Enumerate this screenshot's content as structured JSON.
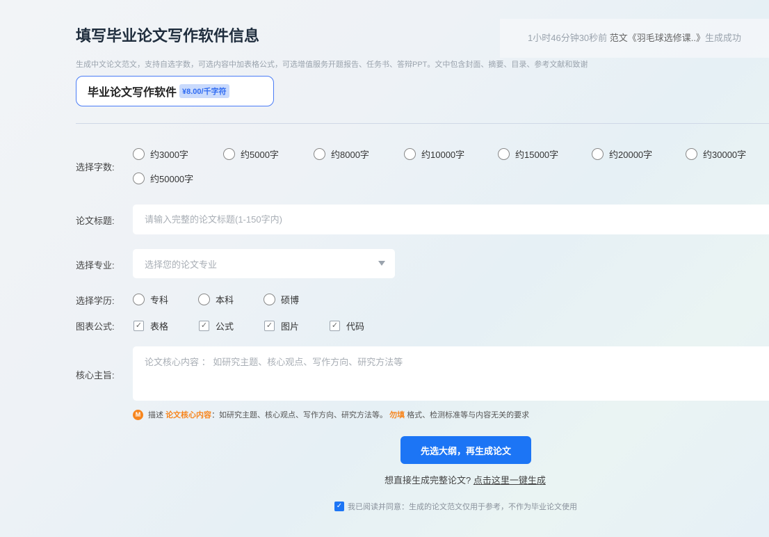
{
  "page_title": "填写毕业论文写作软件信息",
  "notice": {
    "time_text": "1小时46分钟30秒前",
    "mid": "范文《羽毛球选修课..》",
    "status": "生成成功"
  },
  "description": "生成中文论文范文，支持自选字数，可选内容中加表格公式，可选增值服务开题报告、任务书、答辩PPT。文中包含封面、摘要、目录、参考文献和致谢",
  "product": {
    "name": "毕业论文写作软件",
    "price": "¥8.00/千字符"
  },
  "word_count": {
    "label": "选择字数:",
    "options": [
      "约3000字",
      "约5000字",
      "约8000字",
      "约10000字",
      "约15000字",
      "约20000字",
      "约30000字",
      "约50000字"
    ]
  },
  "paper_title": {
    "label": "论文标题:",
    "placeholder": "请输入完整的论文标题(1-150字内)"
  },
  "major": {
    "label": "选择专业:",
    "placeholder": "选择您的论文专业"
  },
  "education": {
    "label": "选择学历:",
    "options": [
      "专科",
      "本科",
      "硕博"
    ]
  },
  "chart_formula": {
    "label": "图表公式:",
    "options": [
      "表格",
      "公式",
      "图片",
      "代码"
    ]
  },
  "core": {
    "label": "核心主旨:",
    "placeholder": "论文核心内容 ： 如研究主题、核心观点、写作方向、研究方法等"
  },
  "hint": {
    "icon_letter": "M",
    "prefix": "描述",
    "highlight1": "论文核心内容",
    "middle": "：如研究主题、核心观点、写作方向、研究方法等。",
    "highlight2": "勿填",
    "suffix": "格式、检测标准等与内容无关的要求"
  },
  "primary_button": "先选大纲，再生成论文",
  "direct": {
    "question": "想直接生成完整论文?",
    "link": "点击这里一键生成"
  },
  "agreement": "我已阅读并同意：生成的论文范文仅用于参考，不作为毕业论文使用",
  "colors": {
    "accent": "#1c75f5",
    "highlight": "#f7861f",
    "price_bg": "#c9dafc"
  },
  "icons": {
    "check": "checkmark-icon",
    "caret": "caret-down-icon",
    "hint": "hint-badge-icon"
  }
}
